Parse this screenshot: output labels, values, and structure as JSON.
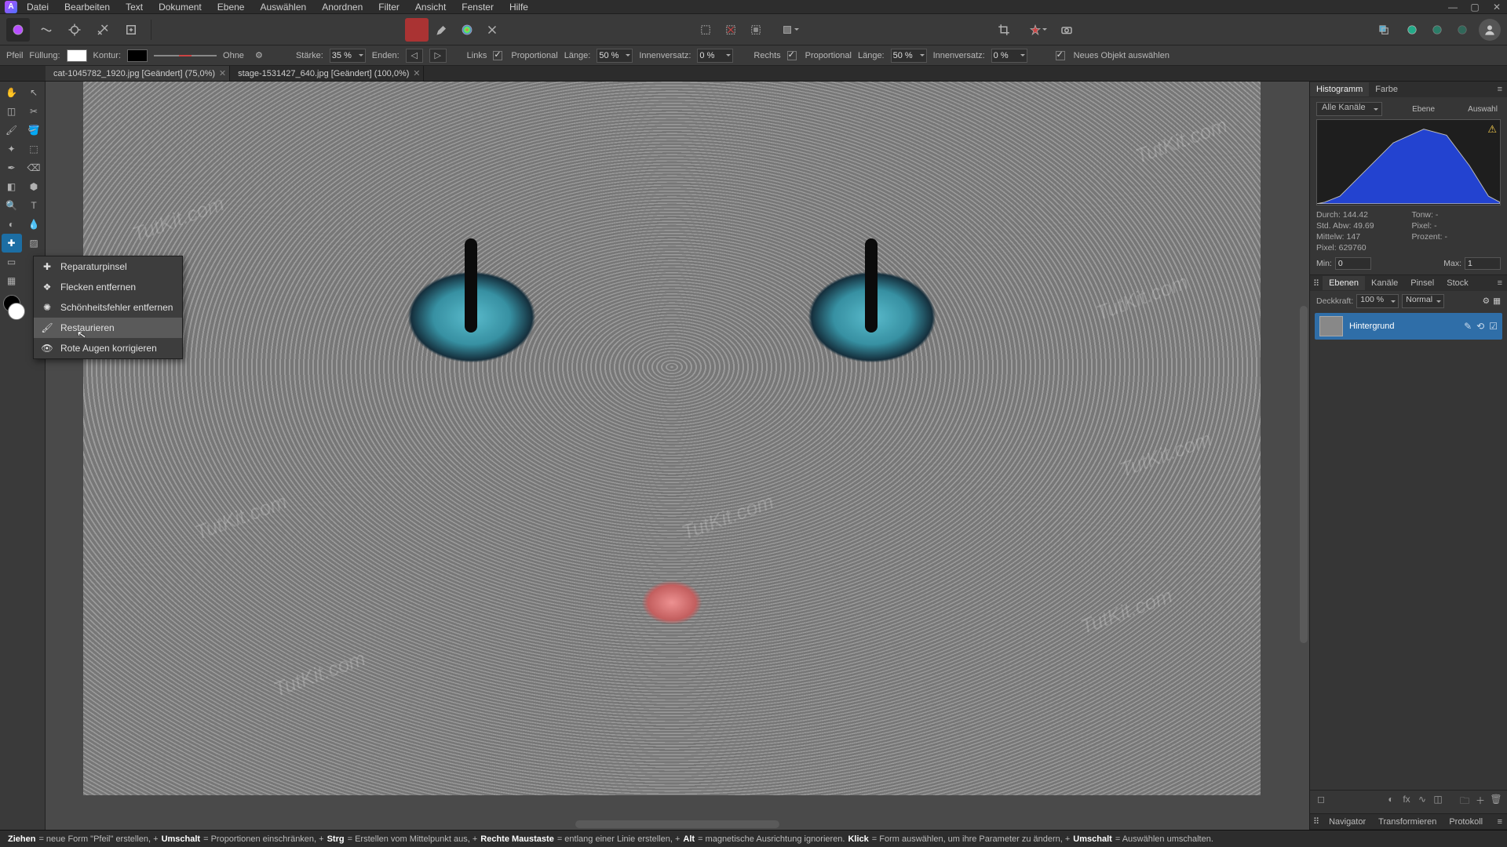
{
  "menubar": {
    "items": [
      "Datei",
      "Bearbeiten",
      "Text",
      "Dokument",
      "Ebene",
      "Auswählen",
      "Anordnen",
      "Filter",
      "Ansicht",
      "Fenster",
      "Hilfe"
    ]
  },
  "context_toolbar": {
    "tool_name": "Pfeil",
    "fill_label": "Füllung:",
    "stroke_label": "Kontur:",
    "style_label": "Ohne",
    "strength_label": "Stärke:",
    "strength_value": "35 %",
    "ends_label": "Enden:",
    "left_label": "Links",
    "proportional_label": "Proportional",
    "length_label": "Länge:",
    "length_left": "50 %",
    "inset_label": "Innenversatz:",
    "inset_left": "0 %",
    "right_label": "Rechts",
    "length_right": "50 %",
    "inset_right": "0 %",
    "newobj_label": "Neues Objekt auswählen"
  },
  "tabs": [
    {
      "title": "cat-1045782_1920.jpg [Geändert] (75,0%)",
      "active": true
    },
    {
      "title": "stage-1531427_640.jpg [Geändert] (100,0%)",
      "active": false
    }
  ],
  "flyout": {
    "items": [
      {
        "key": "healing-brush",
        "label": "Reparaturpinsel"
      },
      {
        "key": "patch",
        "label": "Flecken entfernen"
      },
      {
        "key": "blemish",
        "label": "Schönheitsfehler entfernen"
      },
      {
        "key": "inpaint",
        "label": "Restaurieren",
        "hover": true
      },
      {
        "key": "redeye",
        "label": "Rote Augen korrigieren"
      }
    ]
  },
  "watermark": "TutKit.com",
  "histogram_panel": {
    "tabs": [
      "Histogramm",
      "Farbe"
    ],
    "channel_label": "Alle Kanäle",
    "btn_layer": "Ebene",
    "btn_selection": "Auswahl",
    "stats": {
      "mean_label": "Durch:",
      "mean": "144.42",
      "stdabw_label": "Std. Abw:",
      "stdabw": "49.69",
      "median_label": "Mittelw:",
      "median": "147",
      "pixels_label": "Pixel:",
      "pixels": "629760",
      "tone_label": "Tonw:",
      "tone": "-",
      "pixel2_label": "Pixel:",
      "pixel2": "-",
      "percent_label": "Prozent:",
      "percent": "-"
    },
    "min_label": "Min:",
    "min_value": "0",
    "max_label": "Max:",
    "max_value": "1"
  },
  "layers_panel": {
    "tabs": [
      "Ebenen",
      "Kanäle",
      "Pinsel",
      "Stock"
    ],
    "opacity_label": "Deckkraft:",
    "opacity_value": "100 %",
    "blend_mode": "Normal",
    "layer_name": "Hintergrund"
  },
  "bottom_tabs": [
    "Navigator",
    "Transformieren",
    "Protokoll"
  ],
  "status_bar": {
    "parts": [
      {
        "b": "Ziehen"
      },
      {
        "t": " = neue Form \"Pfeil\" erstellen, +"
      },
      {
        "b": "Umschalt"
      },
      {
        "t": " = Proportionen einschränken, +"
      },
      {
        "b": "Strg"
      },
      {
        "t": " = Erstellen vom Mittelpunkt aus, +"
      },
      {
        "b": "Rechte Maustaste"
      },
      {
        "t": " = entlang einer Linie erstellen, +"
      },
      {
        "b": "Alt"
      },
      {
        "t": " = magnetische Ausrichtung ignorieren. "
      },
      {
        "b": "Klick"
      },
      {
        "t": " = Form auswählen, um ihre Parameter zu ändern, +"
      },
      {
        "b": "Umschalt"
      },
      {
        "t": " = Auswählen umschalten."
      }
    ]
  }
}
